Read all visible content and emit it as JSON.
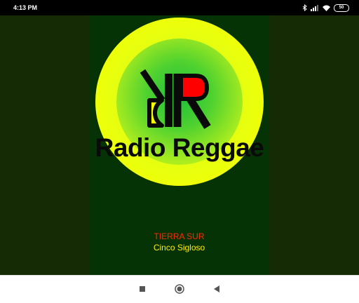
{
  "status_bar": {
    "time": "4:13 PM",
    "battery": "50",
    "icons": [
      "bluetooth-icon",
      "signal-icon",
      "wifi-icon",
      "battery-icon"
    ]
  },
  "logo": {
    "text": "Radio Reggae",
    "colors": {
      "yellow": "#f7ff00",
      "green": "#1bbf3a",
      "red": "#ff0000",
      "black": "#0a0a0a"
    }
  },
  "now_playing": {
    "title": "TIERRA SUR",
    "artist": "Cinco Sigloso"
  },
  "nav_bar": {
    "icons": [
      "recents-icon",
      "home-icon",
      "back-icon"
    ]
  },
  "colors": {
    "background": "#142b06",
    "panel": "#053305",
    "title_color": "#ff2a00",
    "artist_color": "#ffee00"
  }
}
